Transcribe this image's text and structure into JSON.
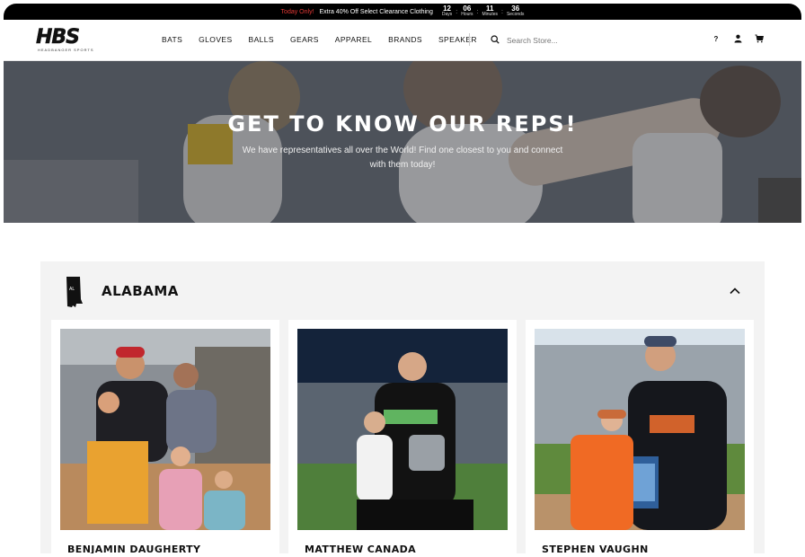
{
  "promo": {
    "highlight": "Today Only!",
    "text": "Extra 40% Off Select Clearance Clothing",
    "countdown": [
      {
        "value": "12",
        "label": "Days"
      },
      {
        "value": "06",
        "label": "Hours"
      },
      {
        "value": "11",
        "label": "Minutes"
      },
      {
        "value": "36",
        "label": "Seconds"
      }
    ]
  },
  "header": {
    "logo_text": "HBS",
    "logo_subtext": "HEADBANGER SPORTS",
    "nav": [
      "BATS",
      "GLOVES",
      "BALLS",
      "GEARS",
      "APPAREL",
      "BRANDS",
      "SPEAKER"
    ],
    "search_placeholder": "Search Store...",
    "help_label": "?",
    "icons": [
      "search-icon",
      "help-icon",
      "account-icon",
      "cart-icon"
    ]
  },
  "hero": {
    "title": "GET TO KNOW OUR REPS!",
    "subtitle": "We have representatives all over the World! Find one closest to you and connect with them today!"
  },
  "section": {
    "state": "ALABAMA",
    "state_abbr": "AL",
    "reps": [
      {
        "name": "BENJAMIN DAUGHERTY"
      },
      {
        "name": "MATTHEW CANADA"
      },
      {
        "name": "STEPHEN VAUGHN"
      }
    ]
  },
  "colors": {
    "promo_bg": "#000000",
    "promo_highlight": "#e53935",
    "section_bg": "#f3f3f3"
  }
}
